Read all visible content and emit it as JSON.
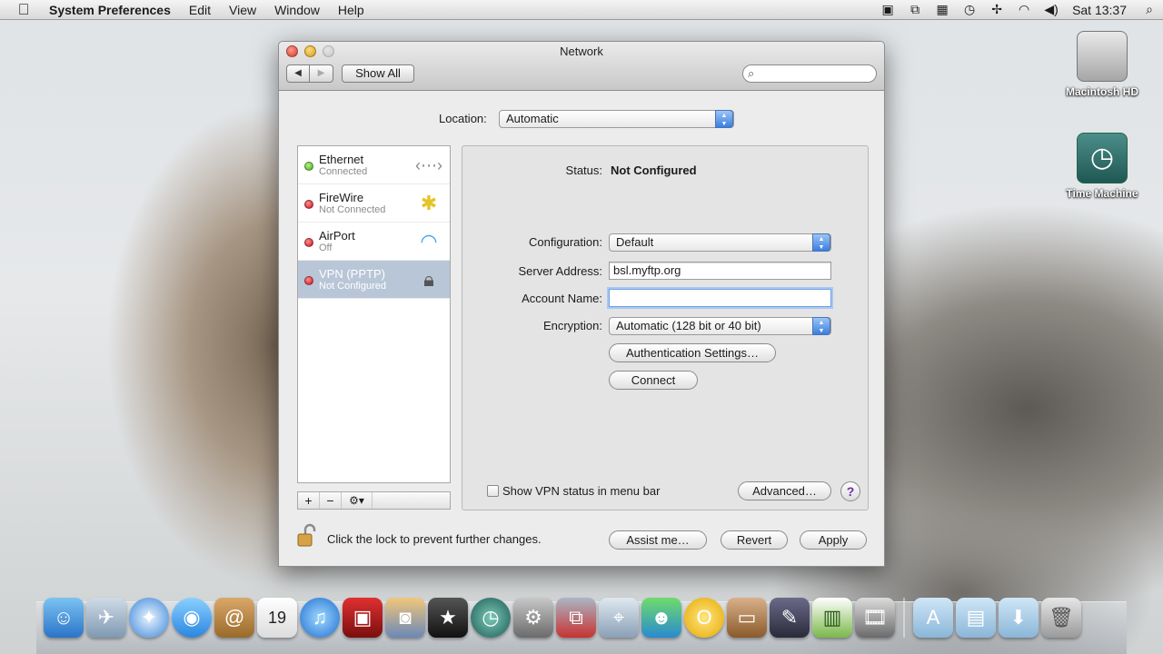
{
  "menubar": {
    "app_name": "System Preferences",
    "items": [
      "Edit",
      "View",
      "Window",
      "Help"
    ],
    "clock": "Sat 13:37",
    "status_icons": [
      "screen-record-icon",
      "sync-icon",
      "grid-icon",
      "time-machine-icon",
      "bluetooth-icon",
      "wifi-icon",
      "volume-icon"
    ]
  },
  "desktop": {
    "icons": [
      {
        "label": "Macintosh HD",
        "icon": "hard-drive-icon"
      },
      {
        "label": "Time Machine",
        "icon": "time-machine-icon"
      }
    ]
  },
  "window": {
    "title": "Network",
    "show_all_label": "Show All",
    "search": {
      "placeholder": "",
      "value": ""
    },
    "location": {
      "label": "Location:",
      "value": "Automatic"
    },
    "services": [
      {
        "name": "Ethernet",
        "status": "Connected",
        "dot": "green",
        "icon": "ethernet-icon",
        "selected": false
      },
      {
        "name": "FireWire",
        "status": "Not Connected",
        "dot": "red",
        "icon": "firewire-icon",
        "selected": false
      },
      {
        "name": "AirPort",
        "status": "Off",
        "dot": "red",
        "icon": "wifi-icon",
        "selected": false
      },
      {
        "name": "VPN (PPTP)",
        "status": "Not Configured",
        "dot": "red",
        "icon": "lock-icon",
        "selected": true
      }
    ],
    "list_toolbar": {
      "add": "+",
      "remove": "−",
      "action": "⚙▾"
    },
    "detail": {
      "status_label": "Status:",
      "status_value": "Not Configured",
      "configuration_label": "Configuration:",
      "configuration_value": "Default",
      "server_address_label": "Server Address:",
      "server_address_value": "bsl.myftp.org",
      "account_name_label": "Account Name:",
      "account_name_value": "",
      "encryption_label": "Encryption:",
      "encryption_value": "Automatic (128 bit or 40 bit)",
      "auth_settings_label": "Authentication Settings…",
      "connect_label": "Connect",
      "show_vpn_status_label": "Show VPN status in menu bar",
      "show_vpn_status_checked": false,
      "advanced_label": "Advanced…",
      "help_label": "?"
    },
    "footer": {
      "lock_text": "Click the lock to prevent further changes.",
      "assist_label": "Assist me…",
      "revert_label": "Revert",
      "apply_label": "Apply"
    }
  },
  "dock": {
    "apps": [
      "finder",
      "mail",
      "safari",
      "ichat",
      "address-book",
      "ical",
      "itunes",
      "photo-booth",
      "iphoto",
      "imovie",
      "time-machine",
      "system-preferences",
      "vmware",
      "network-utility",
      "messenger",
      "opera",
      "keynote",
      "pixelmator",
      "numbers",
      "video-converter"
    ],
    "folders": [
      "applications",
      "documents",
      "downloads",
      "trash"
    ]
  },
  "colors": {
    "selection_blue": "#b8c6d8",
    "popup_arrow_blue": "#3a7ee0",
    "status_green": "#43a81a",
    "status_red": "#c8101e",
    "help_purple": "#6c2fa8"
  }
}
